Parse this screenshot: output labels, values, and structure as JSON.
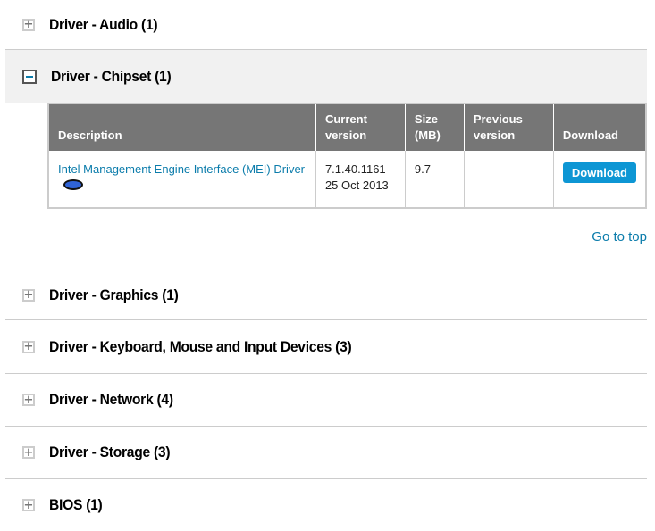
{
  "sections": [
    {
      "title": "Driver - Audio (1)",
      "expanded": false
    },
    {
      "title": "Driver - Chipset (1)",
      "expanded": true
    },
    {
      "title": "Driver - Graphics (1)",
      "expanded": false
    },
    {
      "title": "Driver - Keyboard, Mouse and Input Devices (3)",
      "expanded": false
    },
    {
      "title": "Driver - Network (4)",
      "expanded": false
    },
    {
      "title": "Driver - Storage (3)",
      "expanded": false
    },
    {
      "title": "BIOS (1)",
      "expanded": false
    }
  ],
  "chipset_table": {
    "headers": {
      "description": "Description",
      "current_version": "Current version",
      "size": "Size (MB)",
      "previous_version": "Previous version",
      "download": "Download"
    },
    "rows": [
      {
        "description": "Intel Management Engine Interface (MEI) Driver",
        "icon": "os-icon",
        "version": "7.1.40.1161",
        "date": "25 Oct 2013",
        "size": "9.7",
        "previous_version": "",
        "download_label": "Download"
      }
    ]
  },
  "go_to_top": "Go to top",
  "colors": {
    "link": "#0b7cab",
    "button": "#0d96d4",
    "table_header": "#767676",
    "expanded_bg": "#f1f1f1"
  }
}
